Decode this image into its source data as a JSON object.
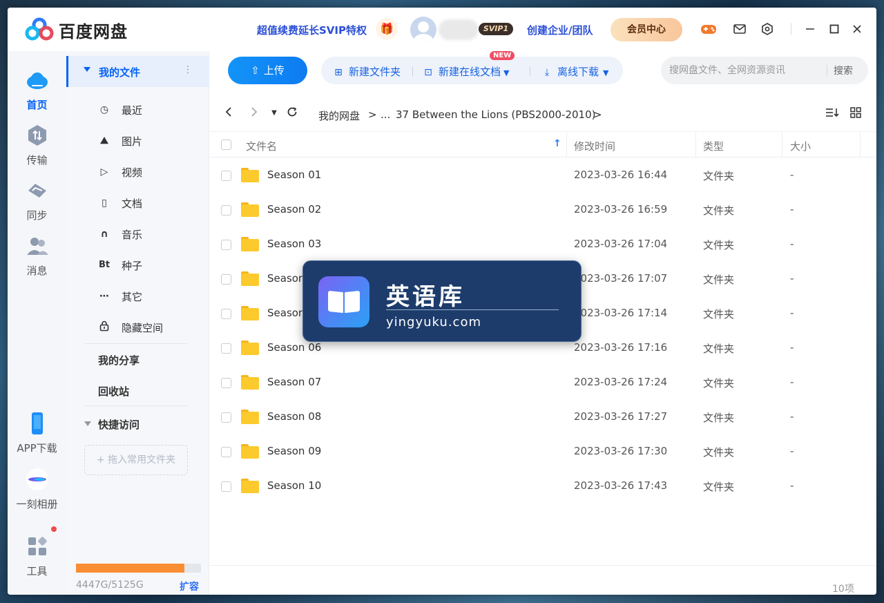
{
  "app": {
    "brand": "百度网盘",
    "promo": "超值续费延长SVIP特权",
    "svip_badge": "SVIP1",
    "enterprise": "创建企业/团队",
    "vip_center": "会员中心"
  },
  "titlebar_icons": [
    "game-icon",
    "mail-icon",
    "settings-icon",
    "minimize-icon",
    "maximize-icon",
    "close-icon"
  ],
  "rail": {
    "items": [
      {
        "label": "首页",
        "icon": "cloud-icon",
        "active": true
      },
      {
        "label": "传输",
        "icon": "transfer-icon"
      },
      {
        "label": "同步",
        "icon": "sync-icon"
      },
      {
        "label": "消息",
        "icon": "message-icon"
      },
      {
        "label": "APP下载",
        "icon": "phone-icon"
      },
      {
        "label": "一刻相册",
        "icon": "album-icon"
      },
      {
        "label": "工具",
        "icon": "tools-icon"
      }
    ]
  },
  "sidebar": {
    "my_files": "我的文件",
    "items": [
      {
        "label": "最近",
        "icon": "clock-icon"
      },
      {
        "label": "图片",
        "icon": "image-icon"
      },
      {
        "label": "视频",
        "icon": "video-icon"
      },
      {
        "label": "文档",
        "icon": "document-icon"
      },
      {
        "label": "音乐",
        "icon": "headphones-icon"
      },
      {
        "label": "种子",
        "icon": "bt-icon"
      },
      {
        "label": "其它",
        "icon": "more-icon"
      },
      {
        "label": "隐藏空间",
        "icon": "lock-icon"
      }
    ],
    "my_share": "我的分享",
    "recycle": "回收站",
    "quick_access": "快捷访问",
    "drop_hint": "+ 拖入常用文件夹",
    "quota": "4447G/5125G",
    "quota_fraction": 0.868,
    "expand": "扩容"
  },
  "toolbar": {
    "upload": "上传",
    "new_folder": "新建文件夹",
    "new_online_doc": "新建在线文档",
    "new_badge": "NEW",
    "offline_download": "离线下载",
    "search_placeholder": "搜网盘文件、全网资源资讯",
    "search_button": "搜索"
  },
  "breadcrumb": {
    "root": "我的网盘",
    "sep": ">",
    "ellipsis": "...",
    "current": "37 Between the Lions (PBS2000-2010)"
  },
  "table": {
    "headers": {
      "name": "文件名",
      "modified": "修改时间",
      "type": "类型",
      "size": "大小"
    },
    "rows": [
      {
        "name": "Season 01",
        "modified": "2023-03-26 16:44",
        "type": "文件夹",
        "size": "-"
      },
      {
        "name": "Season 02",
        "modified": "2023-03-26 16:59",
        "type": "文件夹",
        "size": "-"
      },
      {
        "name": "Season 03",
        "modified": "2023-03-26 17:04",
        "type": "文件夹",
        "size": "-"
      },
      {
        "name": "Season 04",
        "modified": "2023-03-26 17:07",
        "type": "文件夹",
        "size": "-"
      },
      {
        "name": "Season 05",
        "modified": "2023-03-26 17:14",
        "type": "文件夹",
        "size": "-"
      },
      {
        "name": "Season 06",
        "modified": "2023-03-26 17:16",
        "type": "文件夹",
        "size": "-"
      },
      {
        "name": "Season 07",
        "modified": "2023-03-26 17:24",
        "type": "文件夹",
        "size": "-"
      },
      {
        "name": "Season 08",
        "modified": "2023-03-26 17:27",
        "type": "文件夹",
        "size": "-"
      },
      {
        "name": "Season 09",
        "modified": "2023-03-26 17:30",
        "type": "文件夹",
        "size": "-"
      },
      {
        "name": "Season 10",
        "modified": "2023-03-26 17:43",
        "type": "文件夹",
        "size": "-"
      }
    ],
    "count": "10项"
  },
  "watermark": {
    "title": "英语库",
    "url": "yingyuku.com"
  },
  "colors": {
    "accent": "#0663f4",
    "quota": "#fa8e35",
    "folder": "#fcca2c"
  }
}
